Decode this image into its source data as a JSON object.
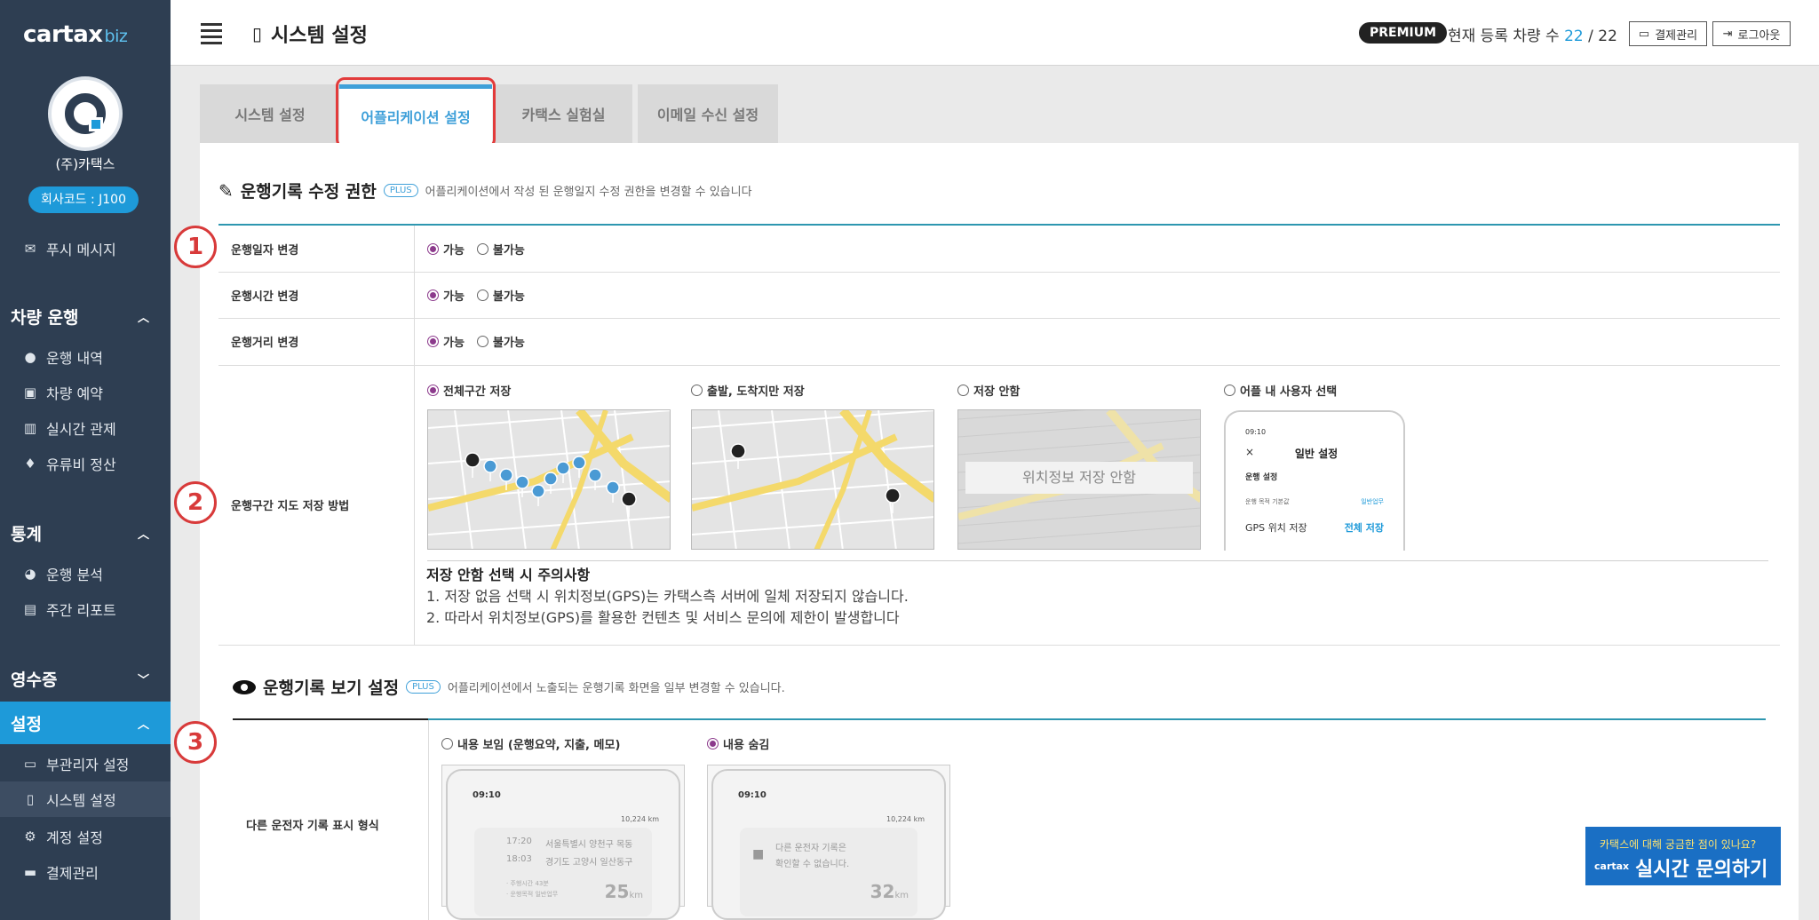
{
  "brand": {
    "logo": "cartax",
    "logo_suffix": "biz"
  },
  "company": {
    "name": "(주)카택스",
    "code": "회사코드 : J100"
  },
  "sidebar": {
    "push_message": "푸시 메시지",
    "sections": [
      {
        "title": "차량 운행",
        "items": [
          "운행 내역",
          "차량 예약",
          "실시간 관제",
          "유류비 정산"
        ]
      },
      {
        "title": "통계",
        "items": [
          "운행 분석",
          "주간 리포트"
        ]
      },
      {
        "title": "영수증",
        "items": []
      },
      {
        "title": "설정",
        "items": [
          "부관리자 설정",
          "시스템 설정",
          "계정 설정",
          "결제관리"
        ]
      }
    ]
  },
  "header": {
    "title": "시스템 설정",
    "badge": "PREMIUM",
    "vehicle_label": "현재 등록 차량 수",
    "vehicle_current": "22",
    "vehicle_sep": " / ",
    "vehicle_total": "22",
    "billing_button": "결제관리",
    "logout_button": "로그아웃"
  },
  "tabs": [
    "시스템 설정",
    "어플리케이션 설정",
    "카택스 실험실",
    "이메일 수신 설정"
  ],
  "active_tab": "어플리케이션 설정",
  "section1": {
    "title": "운행기록 수정 권한",
    "plus": "PLUS",
    "desc": "어플리케이션에서 작성 된 운행일지 수정 권한을 변경할 수 있습니다",
    "rows": [
      {
        "label": "운행일자 변경",
        "options": [
          "가능",
          "불가능"
        ],
        "selected": "가능"
      },
      {
        "label": "운행시간 변경",
        "options": [
          "가능",
          "불가능"
        ],
        "selected": "가능"
      },
      {
        "label": "운행거리 변경",
        "options": [
          "가능",
          "불가능"
        ],
        "selected": "가능"
      }
    ],
    "map_row": {
      "label": "운행구간 지도 저장 방법",
      "options": [
        "전체구간 저장",
        "출발, 도착지만 저장",
        "저장 안함",
        "어플 내 사용자 선택"
      ],
      "selected": "전체구간 저장",
      "no_save_overlay": "위치정보 저장 안함",
      "phone": {
        "time": "09:10",
        "close": "×",
        "title": "일반 설정",
        "group": "운행 설정",
        "row1_label": "운행 목적 기본값",
        "row1_value": "일반업무",
        "row2_label": "GPS 위치 저장",
        "row2_value": "전체 저장"
      },
      "notice_title": "저장 안함 선택 시 주의사항",
      "notice_lines": [
        "1. 저장 없음 선택 시 위치정보(GPS)는 카택스측 서버에 일체 저장되지 않습니다.",
        "2. 따라서 위치정보(GPS)를 활용한 컨텐츠 및 서비스 문의에 제한이 발생합니다"
      ]
    }
  },
  "section2": {
    "title": "운행기록 보기 설정",
    "plus": "PLUS",
    "desc": "어플리케이션에서 노출되는 운행기록 화면을 일부 변경할 수 있습니다.",
    "row_label": "다른 운전자 기록 표시 형식",
    "options": [
      "내용 보임 (운행요약, 지출, 메모)",
      "내용 숨김"
    ],
    "selected": "내용 숨김",
    "phone_show": {
      "time": "09:10",
      "distance_top": "10,224 km",
      "t1": "17:20",
      "p1": "서울특별시 양천구 목동",
      "t2": "18:03",
      "p2": "경기도 고양시 일산동구",
      "s1_label": "· 주행시간",
      "s1_value": "43분",
      "s2_label": "· 운행목적",
      "s2_value": "일반업무",
      "km": "25",
      "km_unit": "km"
    },
    "phone_hide": {
      "time": "09:10",
      "distance_top": "10,224 km",
      "msg1": "다른 운전자 기록은",
      "msg2": "확인할 수 없습니다.",
      "km": "32",
      "km_unit": "km"
    }
  },
  "markers": [
    "1",
    "2",
    "3"
  ],
  "chat": {
    "question": "카택스에 대해 궁금한 점이 있나요?",
    "title": "실시간 문의하기",
    "brand": "cartax"
  }
}
